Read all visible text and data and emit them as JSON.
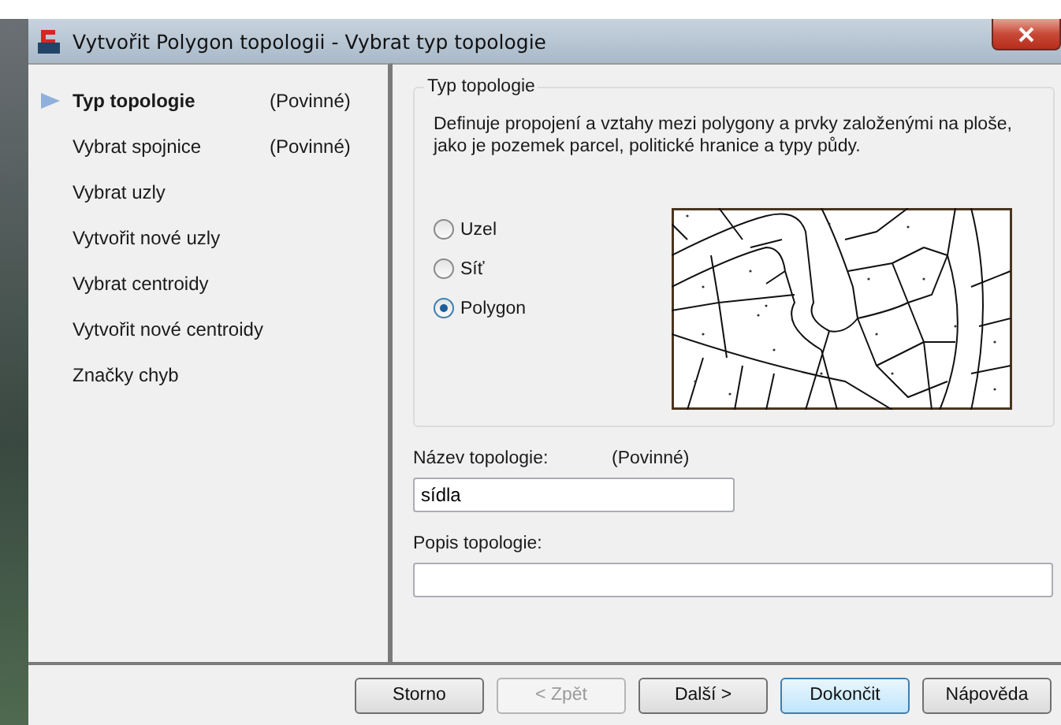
{
  "window": {
    "title": "Vytvořit Polygon topologii - Vybrat typ topologie"
  },
  "steps": [
    {
      "label": "Typ topologie",
      "note": "(Povinné)",
      "selected": true
    },
    {
      "label": "Vybrat spojnice",
      "note": "(Povinné)",
      "selected": false
    },
    {
      "label": "Vybrat uzly",
      "selected": false
    },
    {
      "label": "Vytvořit nové uzly",
      "selected": false
    },
    {
      "label": "Vybrat centroidy",
      "selected": false
    },
    {
      "label": "Vytvořit nové centroidy",
      "selected": false
    },
    {
      "label": "Značky chyb",
      "selected": false
    }
  ],
  "group": {
    "title": "Typ topologie",
    "description": "Definuje propojení a vztahy mezi polygony a prvky založenými na ploše, jako je pozemek parcel, politické hranice a typy půdy.",
    "options": [
      {
        "label": "Uzel",
        "selected": false
      },
      {
        "label": "Síť",
        "selected": false
      },
      {
        "label": "Polygon",
        "selected": true
      }
    ]
  },
  "name_field": {
    "label": "Název topologie:",
    "note": "(Povinné)",
    "value": "sídla"
  },
  "description_field": {
    "label": "Popis topologie:"
  },
  "buttons": [
    {
      "label": "Storno",
      "disabled": false,
      "default": false
    },
    {
      "label": "< Zpět",
      "disabled": true,
      "default": false
    },
    {
      "label": "Další >",
      "disabled": false,
      "default": false
    },
    {
      "label": "Dokončit",
      "disabled": false,
      "default": true
    },
    {
      "label": "Nápověda",
      "disabled": false,
      "default": false
    }
  ]
}
